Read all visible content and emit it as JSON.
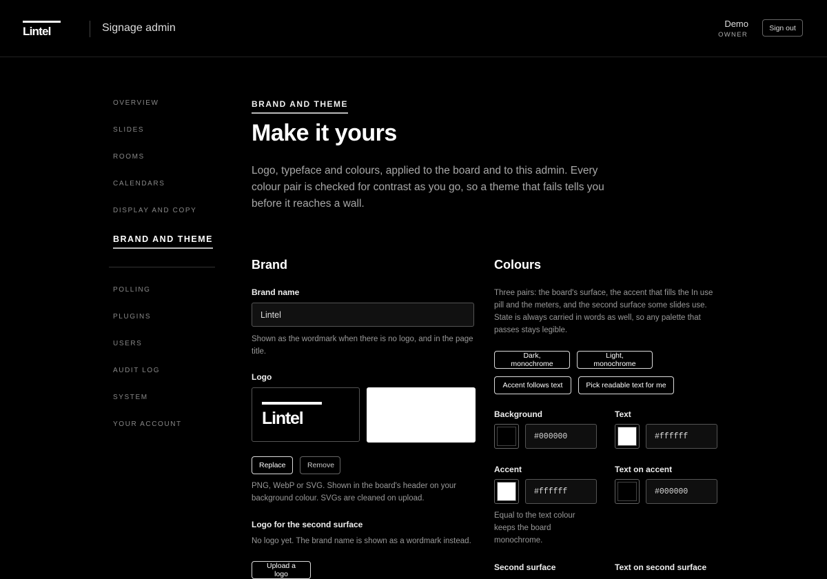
{
  "header": {
    "logo_text": "Lintel",
    "app_title": "Signage admin",
    "user_name": "Demo",
    "user_role": "OWNER",
    "signout_label": "Sign out"
  },
  "sidebar": {
    "items": [
      {
        "label": "OVERVIEW"
      },
      {
        "label": "SLIDES"
      },
      {
        "label": "ROOMS"
      },
      {
        "label": "CALENDARS"
      },
      {
        "label": "DISPLAY AND COPY"
      },
      {
        "label": "BRAND AND THEME",
        "active": true
      },
      {
        "label": "POLLING"
      },
      {
        "label": "PLUGINS"
      },
      {
        "label": "USERS"
      },
      {
        "label": "AUDIT LOG"
      },
      {
        "label": "SYSTEM"
      },
      {
        "label": "YOUR ACCOUNT"
      }
    ]
  },
  "main": {
    "eyebrow": "BRAND AND THEME",
    "title": "Make it yours",
    "lede": "Logo, typeface and colours, applied to the board and to this admin. Every colour pair is checked for contrast as you go, so a theme that fails tells you before it reaches a wall."
  },
  "brand": {
    "heading": "Brand",
    "name_label": "Brand name",
    "name_value": "Lintel",
    "name_help": "Shown as the wordmark when there is no logo, and in the page title.",
    "logo_label": "Logo",
    "logo_preview_text": "Lintel",
    "replace_label": "Replace",
    "remove_label": "Remove",
    "logo_help": "PNG, WebP or SVG. Shown in the board's header on your background colour. SVGs are cleaned on upload.",
    "second_logo_label": "Logo for the second surface",
    "second_logo_help": "No logo yet. The brand name is shown as a wordmark instead.",
    "upload_label": "Upload a logo"
  },
  "colours": {
    "heading": "Colours",
    "intro": "Three pairs: the board's surface, the accent that fills the In use pill and the meters, and the second surface some slides use. State is always carried in words as well, so any palette that passes stays legible.",
    "presets": [
      "Dark, monochrome",
      "Light, monochrome",
      "Accent follows text",
      "Pick readable text for me"
    ],
    "background_label": "Background",
    "background_value": "#000000",
    "text_label": "Text",
    "text_value": "#ffffff",
    "accent_label": "Accent",
    "accent_value": "#ffffff",
    "accent_help": "Equal to the text colour keeps the board monochrome.",
    "text_on_accent_label": "Text on accent",
    "text_on_accent_value": "#000000",
    "second_surface_label": "Second surface",
    "text_on_second_label": "Text on second surface",
    "swatch_colors": {
      "background": "#000000",
      "text": "#ffffff",
      "accent": "#ffffff",
      "text_on_accent": "#000000"
    }
  }
}
